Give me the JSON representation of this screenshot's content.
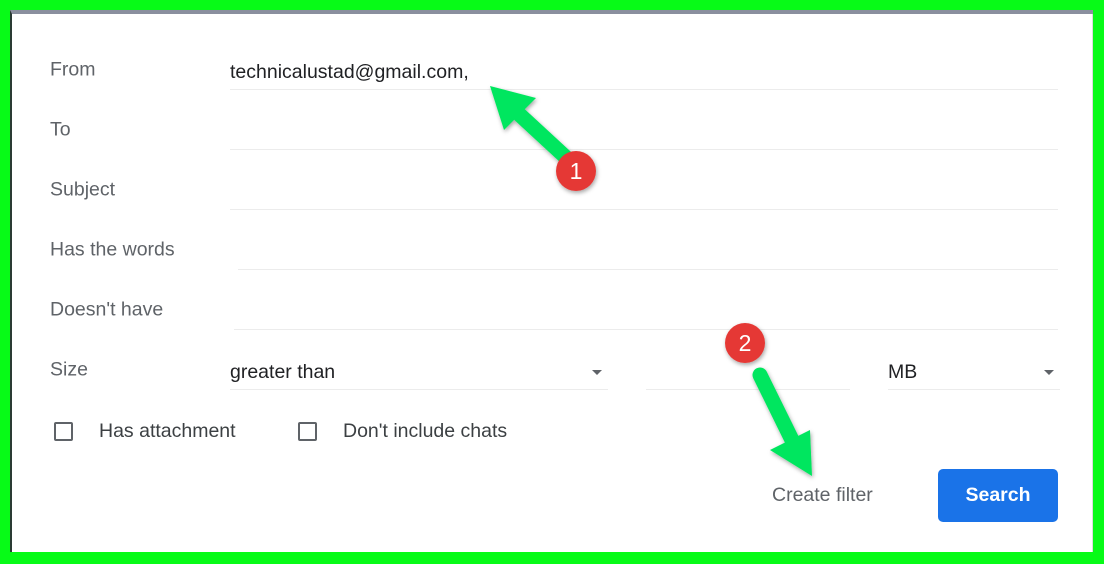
{
  "form": {
    "from": {
      "label": "From",
      "value": "technicalustad@gmail.com,"
    },
    "to": {
      "label": "To",
      "value": ""
    },
    "subject": {
      "label": "Subject",
      "value": ""
    },
    "has_words": {
      "label": "Has the words",
      "value": ""
    },
    "doesnt_have": {
      "label": "Doesn't have",
      "value": ""
    },
    "size": {
      "label": "Size",
      "comparator": "greater than",
      "amount": "",
      "unit": "MB"
    },
    "has_attachment": {
      "label": "Has attachment",
      "checked": false
    },
    "dont_include_chats": {
      "label": "Don't include chats",
      "checked": false
    }
  },
  "actions": {
    "create_filter_label": "Create filter",
    "search_label": "Search"
  },
  "annotations": [
    {
      "number": "1",
      "target": "from-field",
      "icon": "arrow-up-left-icon"
    },
    {
      "number": "2",
      "target": "create-filter-button",
      "icon": "arrow-down-right-icon"
    }
  ],
  "colors": {
    "frame": "#07fb17",
    "accent": "#1a73e8",
    "badge": "#e53935",
    "arrow": "#00e65f"
  }
}
